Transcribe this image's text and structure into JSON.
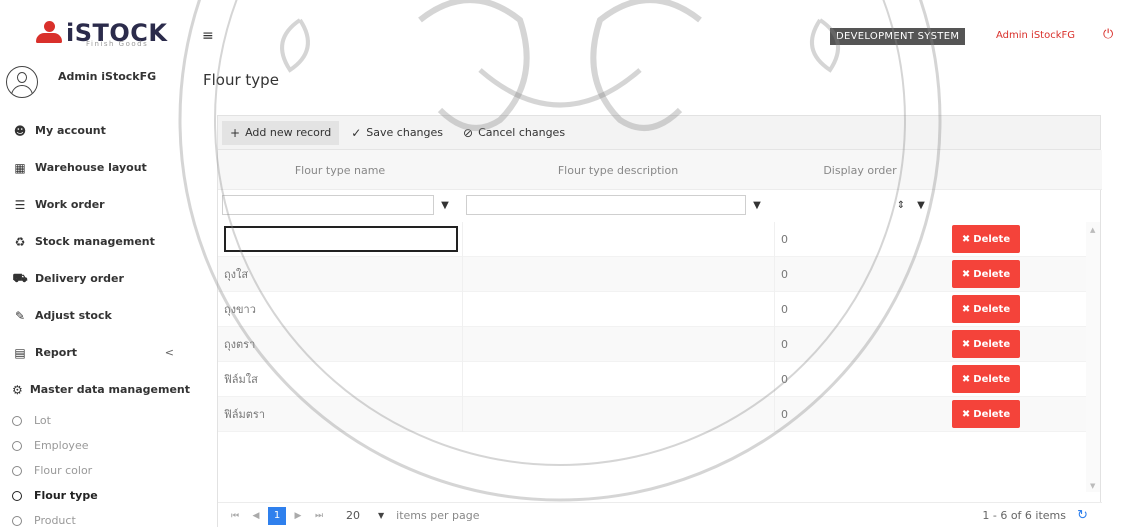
{
  "brand": {
    "name": "iSTOCK",
    "tagline": "Finish Goods",
    "accent": "#d9302b"
  },
  "sidebar": {
    "user_name": "Admin iStockFG",
    "items": [
      {
        "label": "My account",
        "icon": "user-icon"
      },
      {
        "label": "Warehouse layout",
        "icon": "grid-icon"
      },
      {
        "label": "Work order",
        "icon": "list-icon"
      },
      {
        "label": "Stock management",
        "icon": "cubes-icon"
      },
      {
        "label": "Delivery order",
        "icon": "truck-icon"
      },
      {
        "label": "Adjust stock",
        "icon": "edit-icon"
      },
      {
        "label": "Report",
        "icon": "bar-chart-icon",
        "arrow": "<"
      },
      {
        "label": "Master data management",
        "icon": "cogs-icon"
      }
    ],
    "sub_items": [
      {
        "label": "Lot",
        "active": false
      },
      {
        "label": "Employee",
        "active": false
      },
      {
        "label": "Flour color",
        "active": false
      },
      {
        "label": "Flour type",
        "active": true
      },
      {
        "label": "Product",
        "active": false
      }
    ]
  },
  "topbar": {
    "menu_icon": "hamburger-icon",
    "environment_badge": "DEVELOPMENT SYSTEM",
    "user_label": "Admin iStockFG",
    "logout_icon": "power-icon"
  },
  "page": {
    "title": "Flour type"
  },
  "grid": {
    "toolbar": {
      "add_label": "Add new record",
      "save_label": "Save changes",
      "cancel_label": "Cancel changes"
    },
    "columns": [
      "Flour type name",
      "Flour type description",
      "Display order",
      ""
    ],
    "rows": [
      {
        "name": "",
        "description": "",
        "order": "0",
        "delete_label": "Delete",
        "editing": true
      },
      {
        "name": "ถุงใส",
        "description": "",
        "order": "0",
        "delete_label": "Delete"
      },
      {
        "name": "ถุงขาว",
        "description": "",
        "order": "0",
        "delete_label": "Delete"
      },
      {
        "name": "ถุงตรา",
        "description": "",
        "order": "0",
        "delete_label": "Delete"
      },
      {
        "name": "ฟิล์มใส",
        "description": "",
        "order": "0",
        "delete_label": "Delete"
      },
      {
        "name": "ฟิล์มตรา",
        "description": "",
        "order": "0",
        "delete_label": "Delete"
      }
    ],
    "pager": {
      "current_page": "1",
      "page_size": "20",
      "page_size_label": "items per page",
      "info": "1 - 6 of 6 items"
    },
    "delete_color": "#f4433a",
    "pager_color": "#2f80ed"
  }
}
